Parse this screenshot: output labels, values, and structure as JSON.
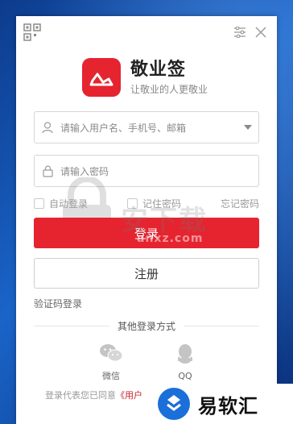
{
  "app": {
    "name": "敬业签",
    "slogan": "让敬业的人更敬业"
  },
  "titlebar": {
    "icons": [
      "qrcode-icon",
      "settings-icon",
      "close-icon"
    ]
  },
  "username": {
    "placeholder": "请输入用户名、手机号、邮箱",
    "icon": "user-icon"
  },
  "password": {
    "placeholder": "请输入密码",
    "icon": "lock-icon"
  },
  "options": {
    "auto_login": "自动登录",
    "remember_password": "记住密码",
    "forgot_password": "忘记密码"
  },
  "buttons": {
    "login": "登录",
    "register": "注册"
  },
  "sms_login": "验证码登录",
  "other_login": {
    "title": "其他登录方式",
    "methods": [
      {
        "label": "微信",
        "icon": "wechat-icon"
      },
      {
        "label": "QQ",
        "icon": "qq-icon"
      }
    ]
  },
  "agreement": {
    "text": "登录代表您已同意",
    "link": "《用户"
  },
  "watermark": {
    "text": "安下载",
    "sub": "anxz.com"
  },
  "badge": {
    "text": "易软汇"
  },
  "colors": {
    "accent": "#e52430",
    "desktop": "#1a64c8"
  }
}
